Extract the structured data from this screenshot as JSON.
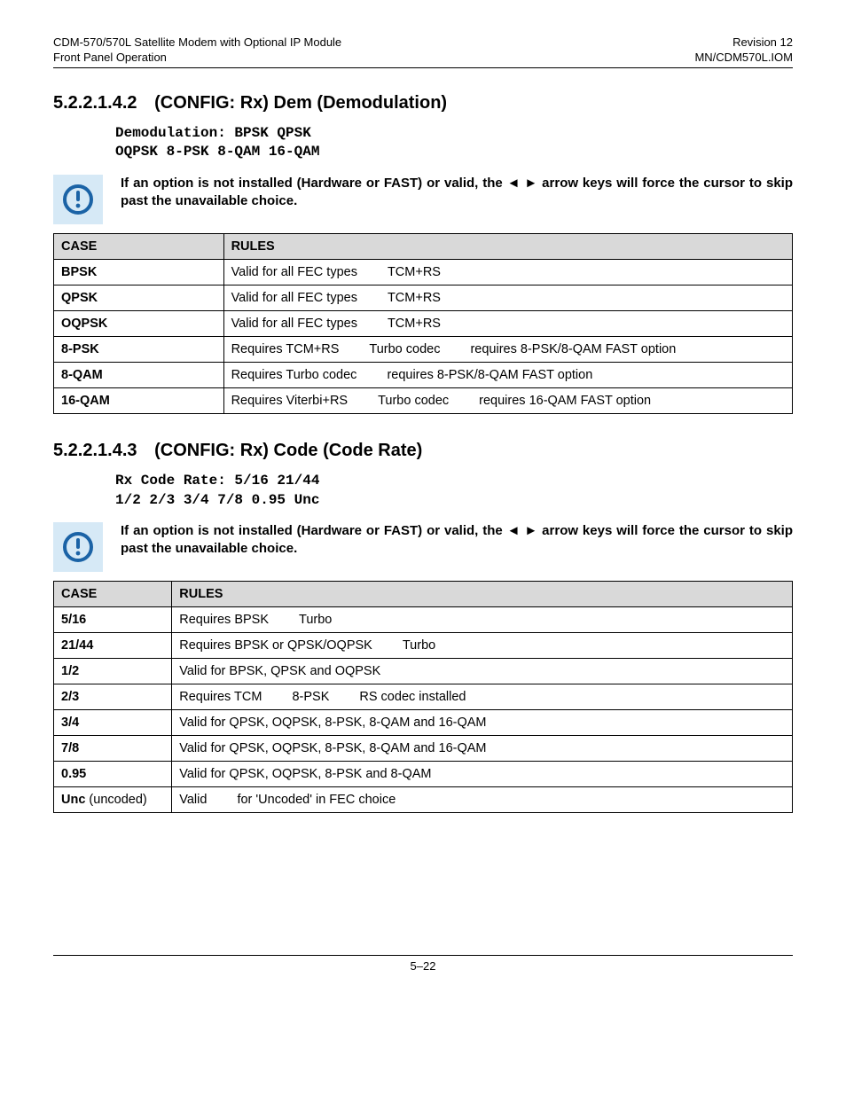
{
  "header": {
    "left1": "CDM-570/570L Satellite Modem with Optional IP Module",
    "left2": "Front Panel Operation",
    "right1": "Revision 12",
    "right2": "MN/CDM570L.IOM"
  },
  "sections": {
    "s1": {
      "num": "5.2.2.1.4.2",
      "title": "(CONFIG: Rx) Dem (Demodulation)",
      "code1": "Demodulation: BPSK QPSK",
      "code2": "OQPSK 8-PSK 8-QAM 16-QAM",
      "notice": "If an option is not installed (Hardware or FAST) or valid, the ◄ ► arrow keys will force the cursor to skip past the unavailable choice.",
      "th1": "CASE",
      "th2": "RULES",
      "rows": [
        {
          "case": "BPSK",
          "parts": [
            "Valid for all FEC types",
            "TCM+RS"
          ]
        },
        {
          "case": "QPSK",
          "parts": [
            "Valid for all FEC types",
            "TCM+RS"
          ]
        },
        {
          "case": "OQPSK",
          "parts": [
            "Valid for all FEC types",
            "TCM+RS"
          ]
        },
        {
          "case": "8-PSK",
          "parts": [
            "Requires TCM+RS",
            "Turbo codec",
            "requires 8-PSK/8-QAM FAST option"
          ]
        },
        {
          "case": "8-QAM",
          "parts": [
            "Requires Turbo codec",
            "requires 8-PSK/8-QAM FAST option"
          ]
        },
        {
          "case": "16-QAM",
          "parts": [
            "Requires Viterbi+RS",
            "Turbo codec",
            "requires 16-QAM FAST option"
          ]
        }
      ]
    },
    "s2": {
      "num": "5.2.2.1.4.3",
      "title": "(CONFIG: Rx) Code (Code Rate)",
      "code1": "Rx Code Rate: 5/16 21/44",
      "code2": "1/2 2/3 3/4 7/8 0.95 Unc",
      "notice": "If an option is not installed (Hardware or FAST) or valid, the ◄ ► arrow keys will force the cursor to skip past the unavailable choice.",
      "th1": "CASE",
      "th2": "RULES",
      "rows": [
        {
          "case": "5/16",
          "parts": [
            "Requires BPSK",
            "Turbo"
          ]
        },
        {
          "case": "21/44",
          "parts": [
            "Requires BPSK or QPSK/OQPSK",
            "Turbo"
          ]
        },
        {
          "case": "1/2",
          "parts": [
            "Valid for BPSK, QPSK and OQPSK"
          ]
        },
        {
          "case": "2/3",
          "parts": [
            "Requires TCM",
            "8-PSK",
            "RS codec installed"
          ]
        },
        {
          "case": "3/4",
          "parts": [
            "Valid for QPSK, OQPSK, 8-PSK, 8-QAM and 16-QAM"
          ]
        },
        {
          "case": "7/8",
          "parts": [
            "Valid for QPSK, OQPSK, 8-PSK, 8-QAM and 16-QAM"
          ]
        },
        {
          "case": "0.95",
          "parts": [
            "Valid for QPSK, OQPSK, 8-PSK and 8-QAM"
          ]
        },
        {
          "case": "Unc",
          "case_extra": " (uncoded)",
          "parts": [
            "Valid",
            "for 'Uncoded' in FEC choice"
          ]
        }
      ]
    }
  },
  "footer": "5–22"
}
